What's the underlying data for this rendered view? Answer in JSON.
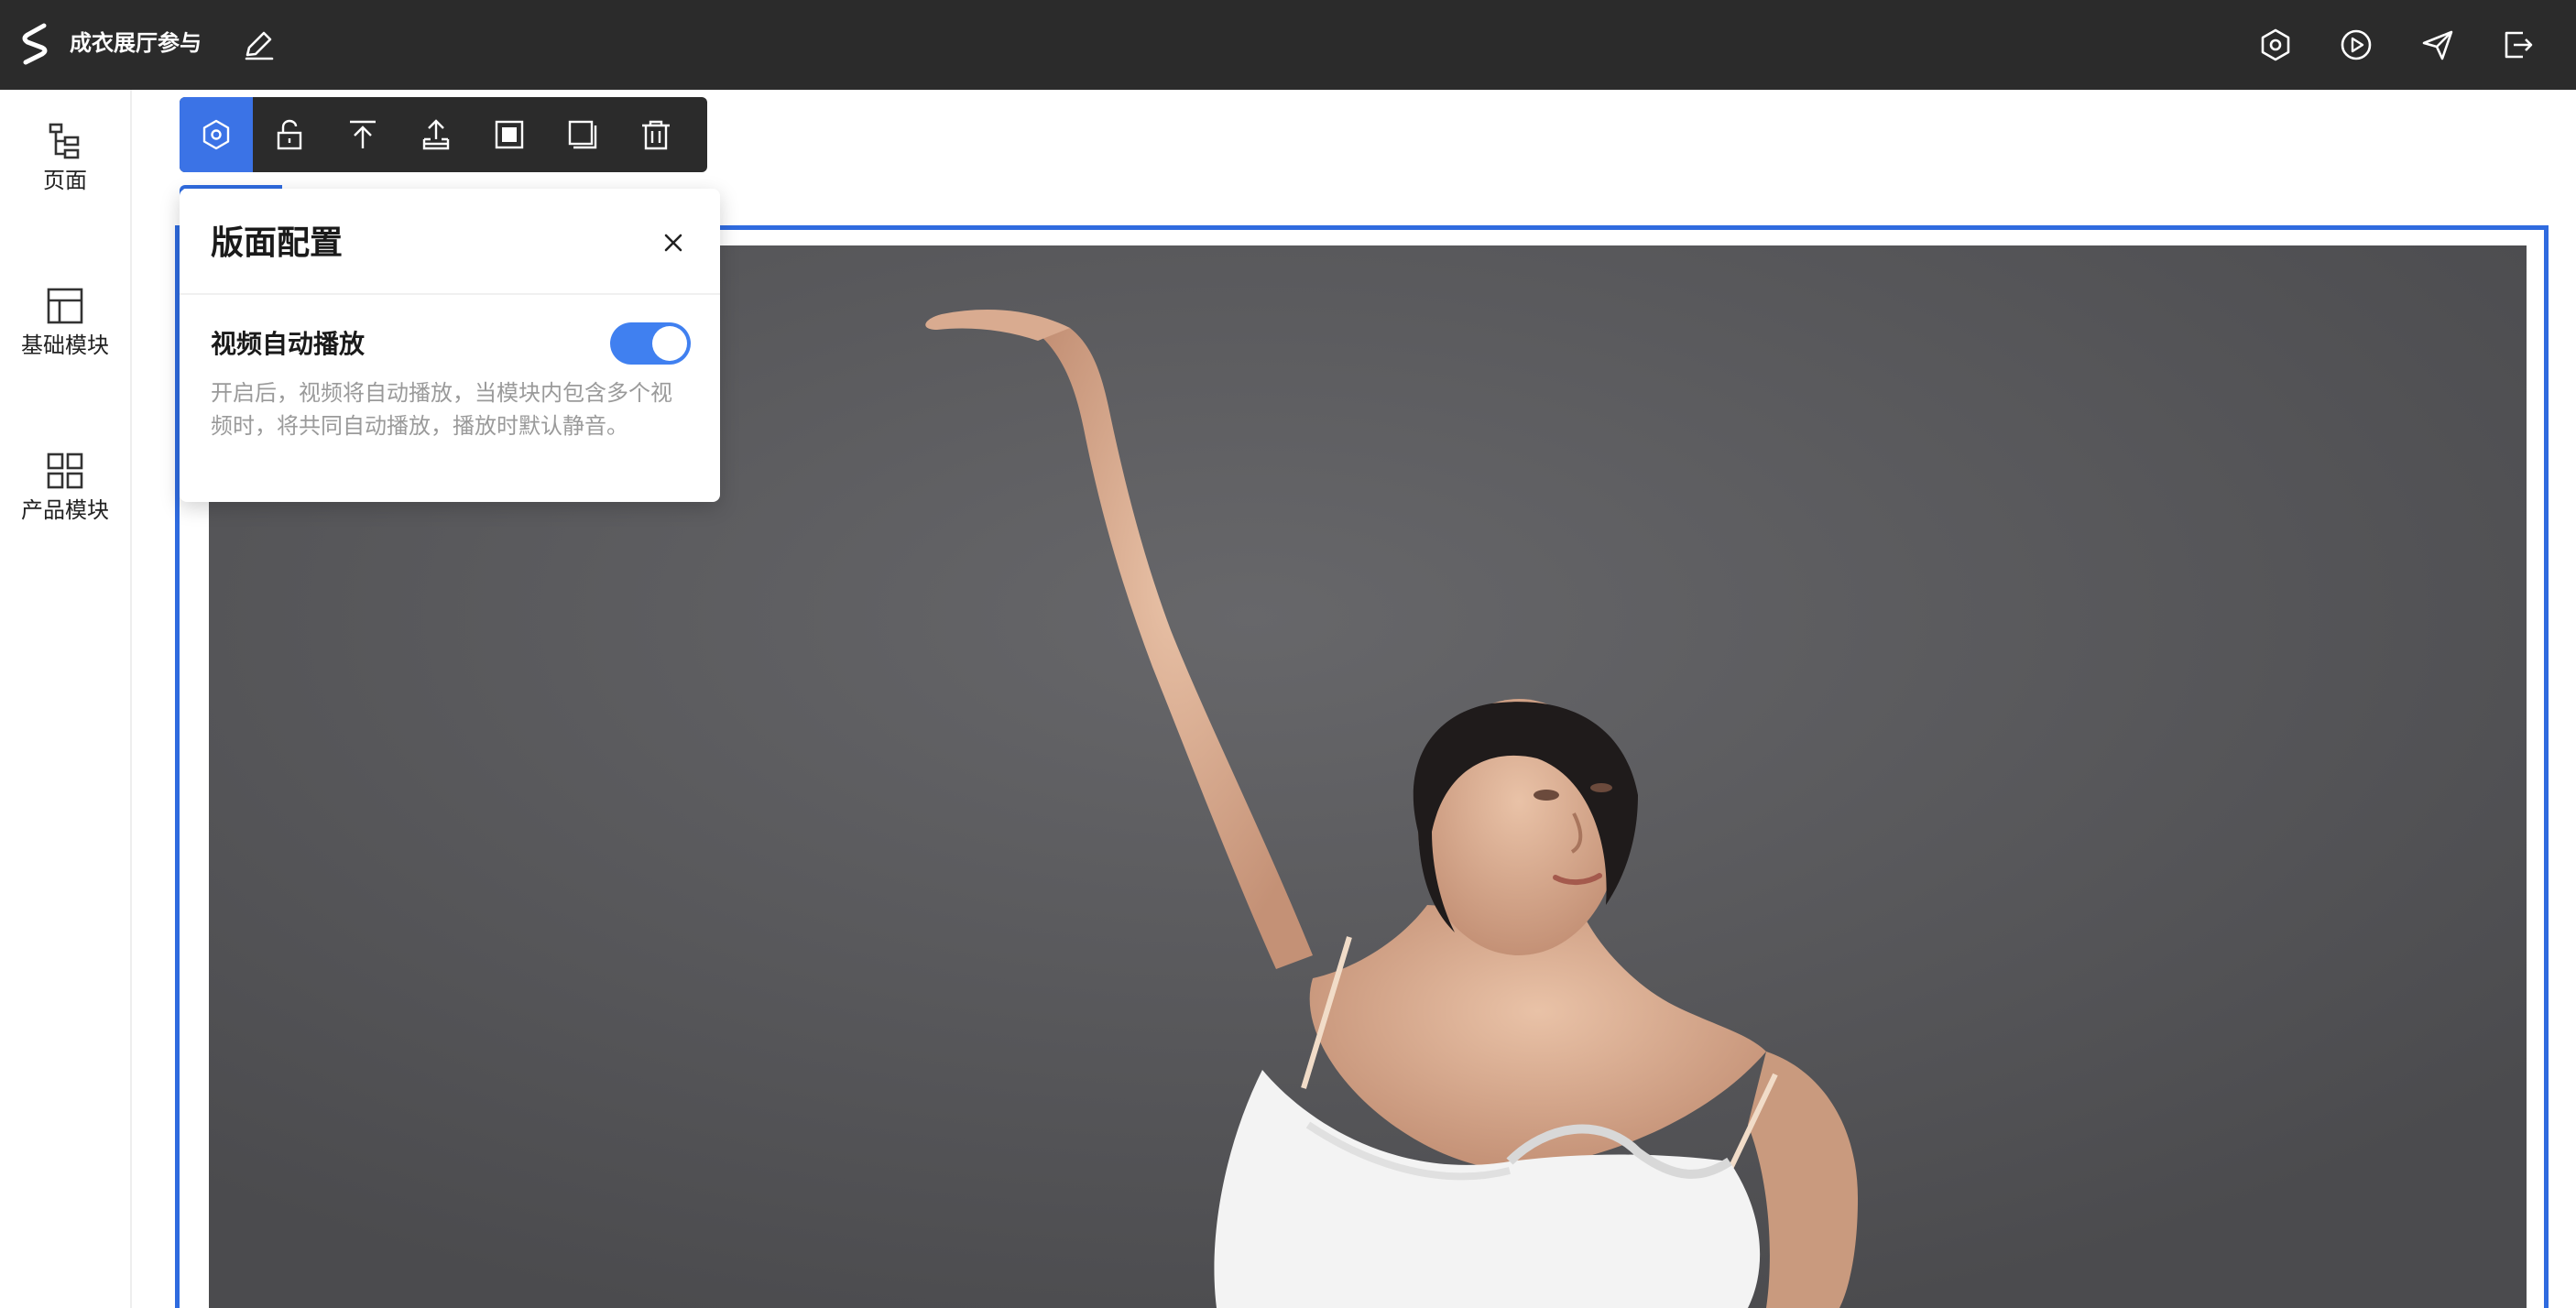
{
  "header": {
    "title": "成衣展厅参与",
    "icons": {
      "logo": "brand-s-logo",
      "edit": "edit-pencil-icon",
      "settings": "settings-icon",
      "preview": "play-preview-icon",
      "publish": "send-icon",
      "exit": "exit-icon"
    }
  },
  "sidebar": {
    "items": [
      {
        "label": "页面",
        "icon": "page-tree-icon"
      },
      {
        "label": "基础模块",
        "icon": "layout-icon"
      },
      {
        "label": "产品模块",
        "icon": "grid-icon"
      }
    ]
  },
  "toolbar": {
    "active_tool": "settings",
    "tools": [
      "settings-icon",
      "unlock-icon",
      "move-to-top-icon",
      "upload-icon",
      "fill-icon",
      "shadow-icon",
      "delete-icon"
    ]
  },
  "panel": {
    "title": "版面配置",
    "setting": {
      "label": "视频自动播放",
      "enabled": true,
      "description": "开启后，视频将自动播放，当模块内包含多个视频时，将共同自动播放，播放时默认静音。"
    }
  },
  "colors": {
    "accent": "#3b73e6",
    "toggle_on": "#4080f0",
    "topbar_bg": "#2b2b2b",
    "selection": "#2f6bdf"
  }
}
